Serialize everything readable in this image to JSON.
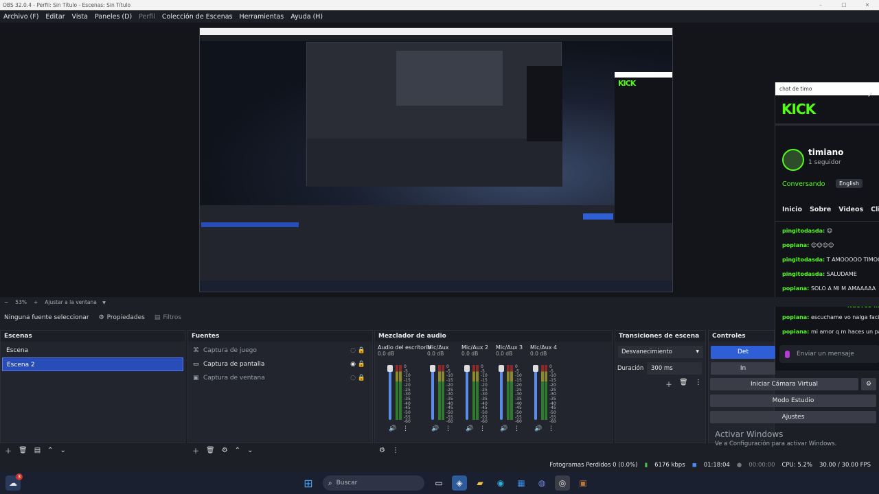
{
  "window": {
    "title": "OBS 32.0.4 - Perfil: Sin Título - Escenas: Sin Título",
    "min": "–",
    "max": "☐",
    "close": "✕"
  },
  "menu": {
    "items": [
      "Archivo (F)",
      "Editar",
      "Vista",
      "Paneles (D)",
      "Perfil",
      "Colección de Escenas",
      "Herramientas",
      "Ayuda (H)"
    ],
    "disabled_index": 4
  },
  "chat": {
    "window_title": "chat de timo",
    "brand": "KICK",
    "channel": "timiano",
    "followers": "1 seguidor",
    "status": "Conversando",
    "language": "English",
    "nav": [
      "Inicio",
      "Sobre",
      "Videos",
      "Clips"
    ],
    "messages": [
      {
        "user": "pingitodasda:",
        "text": "☺"
      },
      {
        "user": "popiana:",
        "text": "☺☺☺☺"
      },
      {
        "user": "pingitodasda:",
        "text": "T AMOOOOO TIMOO"
      },
      {
        "user": "pingitodasda:",
        "text": "SALUDAME"
      },
      {
        "user": "popiana:",
        "text": "SOLO A MI M AMAAAAA"
      }
    ],
    "new_label": "Nuevos m",
    "messages_after": [
      {
        "user": "popiana:",
        "text": "escuchame vo nalga facil"
      },
      {
        "user": "popiana:",
        "text": "mi amor q m haces un pa"
      }
    ],
    "input_placeholder": "Enviar un mensaje"
  },
  "zoom": {
    "minus": "−",
    "value": "53%",
    "plus": "+",
    "fit_label": "Ajustar a la ventana"
  },
  "source_toolbar": {
    "no_source": "Ninguna fuente seleccionar",
    "properties": "Propiedades",
    "filters": "Filtros"
  },
  "scenes": {
    "title": "Escenas",
    "items": [
      "Escena",
      "Escena 2"
    ],
    "selected_index": 1
  },
  "sources": {
    "title": "Fuentes",
    "items": [
      {
        "name": "Captura de juego",
        "visible": false
      },
      {
        "name": "Captura de pantalla",
        "visible": true
      },
      {
        "name": "Captura de ventana",
        "visible": false
      }
    ]
  },
  "mixer": {
    "title": "Mezclador de audio",
    "channels": [
      {
        "name": "Audio del escritorio",
        "db": "0.0 dB"
      },
      {
        "name": "Mic/Aux",
        "db": "0.0 dB"
      },
      {
        "name": "Mic/Aux 2",
        "db": "0.0 dB"
      },
      {
        "name": "Mic/Aux 3",
        "db": "0.0 dB"
      },
      {
        "name": "Mic/Aux 4",
        "db": "0.0 dB"
      }
    ],
    "ticks": [
      "0",
      "-5",
      "-10",
      "-15",
      "-20",
      "-25",
      "-30",
      "-35",
      "-40",
      "-45",
      "-50",
      "-55",
      "-60"
    ]
  },
  "transitions": {
    "title": "Transiciones de escena",
    "selected": "Desvanecimiento",
    "duration_label": "Duración",
    "duration_value": "300 ms"
  },
  "controls": {
    "title": "Controles",
    "stop_stream": "Det",
    "record": "In",
    "virtual_cam": "Iniciar Cámara Virtual",
    "studio_mode": "Modo Estudio",
    "settings": "Ajustes"
  },
  "activation": {
    "title": "Activar Windows",
    "subtitle": "Ve a Configuración para activar Windows."
  },
  "status": {
    "dropped": "Fotogramas Perdidos 0 (0.0%)",
    "bitrate": "6176 kbps",
    "stream_time": "01:18:04",
    "rec_time": "00:00:00",
    "cpu": "CPU: 5.2%",
    "fps": "30.00 / 30.00 FPS"
  },
  "taskbar": {
    "search_placeholder": "Buscar",
    "badge": "3"
  },
  "colors": {
    "accent": "#284cb8",
    "kick_green": "#53fc18",
    "panel": "#22252d",
    "bg": "#1d1f26"
  }
}
